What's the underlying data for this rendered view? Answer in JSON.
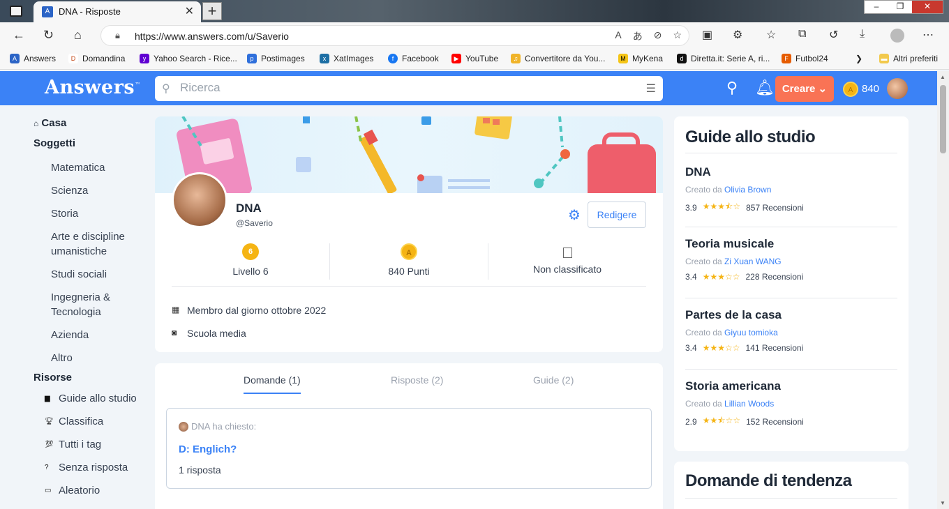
{
  "browser": {
    "tab_title": "DNA - Risposte",
    "url": "https://www.answers.com/u/Saverio",
    "bookmarks": [
      "Answers",
      "Domandina",
      "Yahoo Search - Rice...",
      "Postimages",
      "XatImages",
      "Facebook",
      "YouTube",
      "Convertitore da You...",
      "MyKena",
      "Diretta.it: Serie A, ri...",
      "Futbol24",
      "Altri preferiti"
    ]
  },
  "header": {
    "logo": "Answers",
    "logo_tm": "™",
    "search_placeholder": "Ricerca",
    "create_label": "Creare",
    "points": "840"
  },
  "sidebar": {
    "home": "Casa",
    "subjects_heading": "Soggetti",
    "subjects": [
      "Matematica",
      "Scienza",
      "Storia",
      "Arte e discipline umanistiche",
      "Studi sociali",
      "Ingegneria & Tecnologia",
      "Azienda",
      "Altro"
    ],
    "resources_heading": "Risorse",
    "resources": [
      "Guide allo studio",
      "Classifica",
      "Tutti i tag",
      "Senza risposta",
      "Aleatorio"
    ]
  },
  "profile": {
    "name": "DNA",
    "username": "@Saverio",
    "edit_label": "Redigere",
    "level_badge": "6",
    "level_label": "Livello 6",
    "points_label": "840 Punti",
    "rank_label": "Non classificato",
    "member_since": "Membro dal giorno ottobre 2022",
    "school": "Scuola media"
  },
  "tabs": {
    "questions": "Domande (1)",
    "answers": "Risposte (2)",
    "guides": "Guide (2)"
  },
  "question": {
    "asked": "DNA ha chiesto:",
    "title": "D: Englich?",
    "answers": "1 risposta"
  },
  "guides": {
    "heading": "Guide allo studio",
    "created_by": "Creato da",
    "items": [
      {
        "title": "DNA",
        "author": "Olivia Brown",
        "rating": "3.9",
        "stars": "★★★⯪☆",
        "reviews": "857 Recensioni"
      },
      {
        "title": "Teoria musicale",
        "author": "Zi Xuan WANG",
        "rating": "3.4",
        "stars": "★★★☆☆",
        "reviews": "228 Recensioni"
      },
      {
        "title": "Partes de la casa",
        "author": "Giyuu tomioka",
        "rating": "3.4",
        "stars": "★★★☆☆",
        "reviews": "141 Recensioni"
      },
      {
        "title": "Storia americana",
        "author": "Lillian Woods",
        "rating": "2.9",
        "stars": "★★⯪☆☆",
        "reviews": "152 Recensioni"
      }
    ]
  },
  "trending": {
    "heading": "Domande di tendenza"
  },
  "colors": {
    "brand": "#3b82f6",
    "create": "#f97355",
    "gold": "#f5b414"
  }
}
